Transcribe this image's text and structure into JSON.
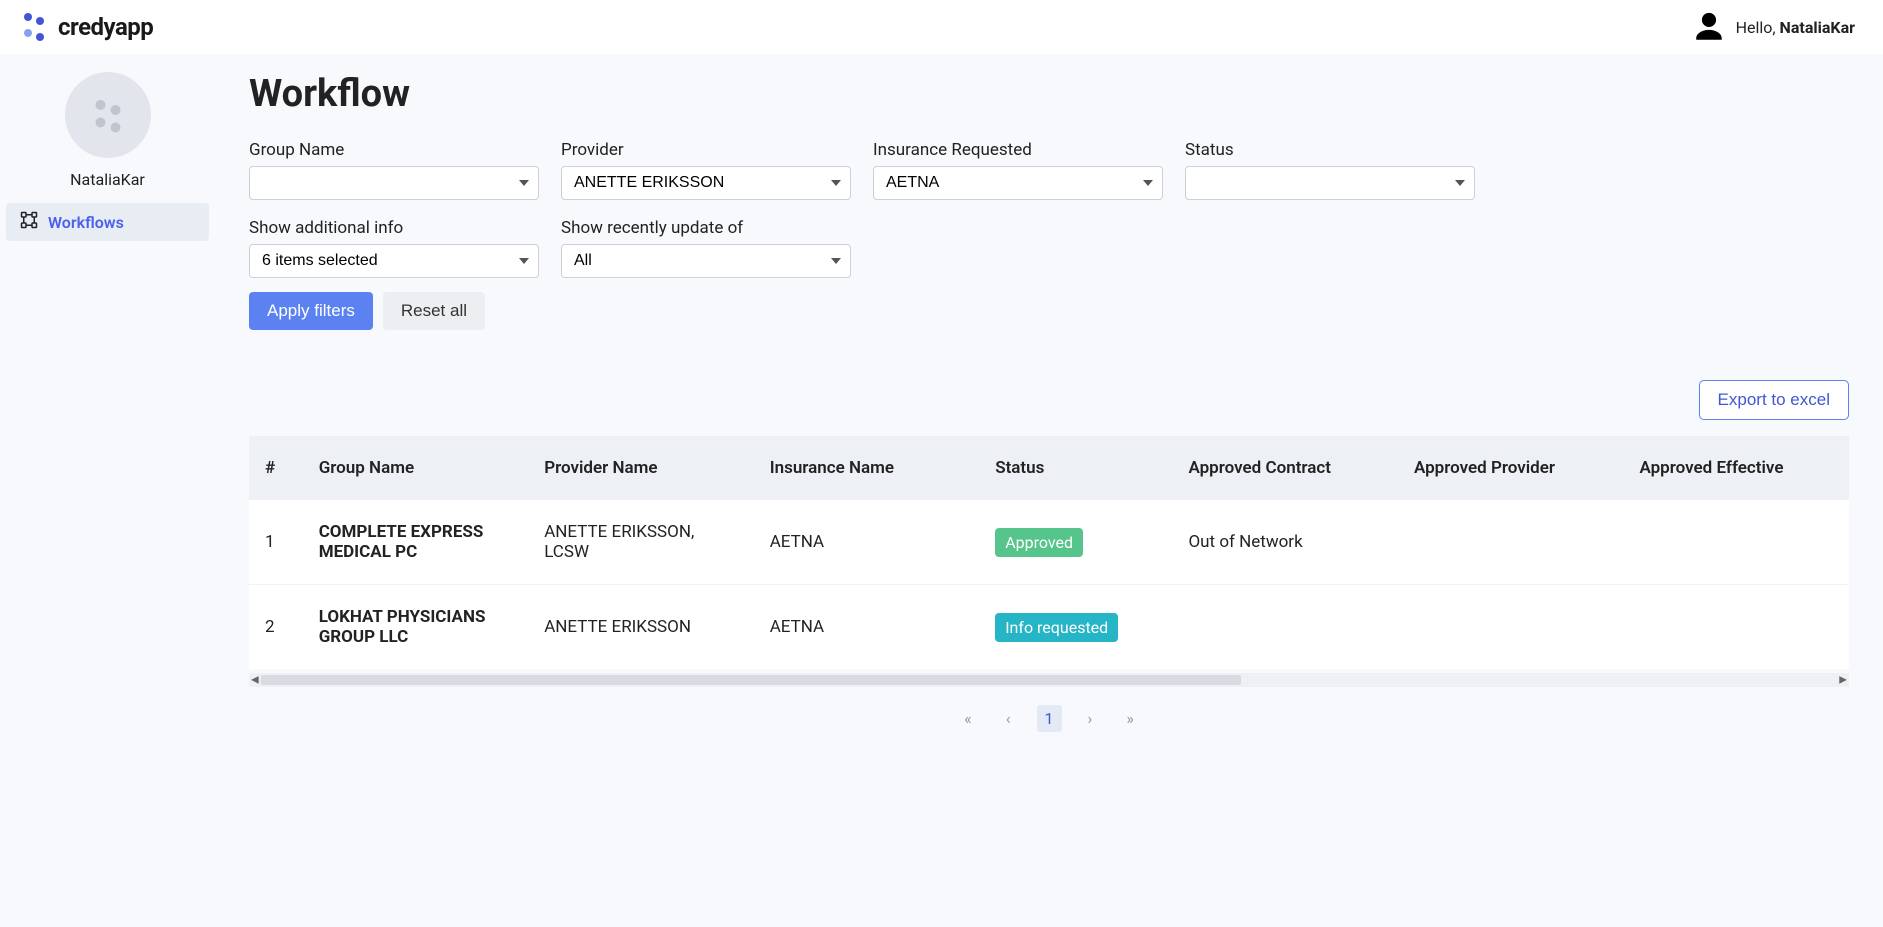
{
  "brand": "credyapp",
  "header": {
    "hello_prefix": "Hello, ",
    "username": "NataliaKar"
  },
  "sidebar": {
    "username": "NataliaKar",
    "items": [
      {
        "label": "Workflows",
        "active": true
      }
    ]
  },
  "page": {
    "title": "Workflow"
  },
  "filters": {
    "group_name": {
      "label": "Group Name",
      "value": ""
    },
    "provider": {
      "label": "Provider",
      "value": "ANETTE ERIKSSON"
    },
    "insurance": {
      "label": "Insurance Requested",
      "value": "AETNA"
    },
    "status": {
      "label": "Status",
      "value": ""
    },
    "show_additional": {
      "label": "Show additional info",
      "value": "6 items selected"
    },
    "show_recent": {
      "label": "Show recently update of",
      "value": "All"
    },
    "apply_label": "Apply filters",
    "reset_label": "Reset all"
  },
  "export_label": "Export to excel",
  "table": {
    "columns": [
      "#",
      "Group Name",
      "Provider Name",
      "Insurance Name",
      "Status",
      "Approved Contract",
      "Approved Provider",
      "Approved Effective"
    ],
    "rows": [
      {
        "n": "1",
        "group": "COMPLETE EXPRESS MEDICAL PC",
        "provider": "ANETTE ERIKSSON, LCSW",
        "insurance": "AETNA",
        "status": "Approved",
        "status_class": "badge-green",
        "approved_contract": "Out of Network",
        "approved_provider": "",
        "approved_effective": ""
      },
      {
        "n": "2",
        "group": "LOKHAT PHYSICIANS GROUP LLC",
        "provider": "ANETTE ERIKSSON",
        "insurance": "AETNA",
        "status": "Info requested",
        "status_class": "badge-teal",
        "approved_contract": "",
        "approved_provider": "",
        "approved_effective": ""
      }
    ]
  },
  "pagination": {
    "current": "1"
  }
}
